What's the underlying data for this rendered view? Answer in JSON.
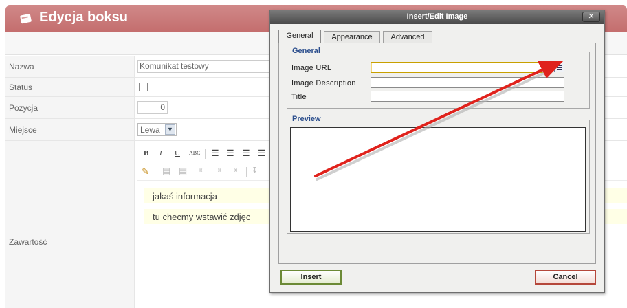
{
  "page": {
    "title": "Edycja boksu",
    "fields": {
      "nazwa_label": "Nazwa",
      "nazwa_value": "Komunikat testowy",
      "status_label": "Status",
      "pozycja_label": "Pozycja",
      "pozycja_value": "0",
      "miejsce_label": "Miejsce",
      "miejsce_value": "Lewa",
      "zawartosc_label": "Zawartość"
    },
    "editor": {
      "lines": [
        "jakaś informacja",
        "tu checmy wstawić zdjęc"
      ]
    }
  },
  "dialog": {
    "title": "Insert/Edit Image",
    "close_label": "✕",
    "tabs": [
      {
        "label": "General",
        "active": true
      },
      {
        "label": "Appearance",
        "active": false
      },
      {
        "label": "Advanced",
        "active": false
      }
    ],
    "general_legend": "General",
    "image_url_label": "Image URL",
    "image_url_value": "",
    "image_description_label": "Image Description",
    "title_label": "Title",
    "preview_legend": "Preview",
    "insert_label": "Insert",
    "cancel_label": "Cancel"
  },
  "colors": {
    "header": "#c46e6e",
    "legend": "#2a4d8c",
    "arrow": "#e0221c",
    "focus_border": "#c8a000"
  }
}
